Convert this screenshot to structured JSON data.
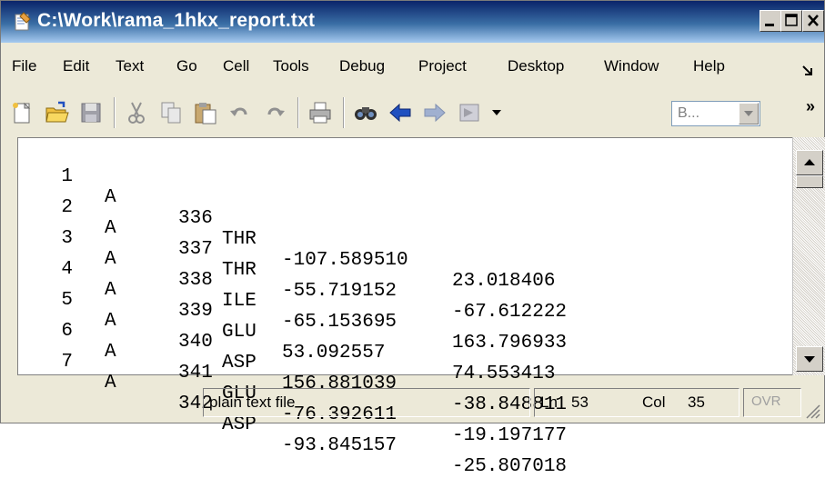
{
  "window": {
    "title": "C:\\Work\\rama_1hkx_report.txt",
    "minimize_label": "minimize",
    "maximize_label": "maximize",
    "close_label": "close"
  },
  "menu": [
    "File",
    "Edit",
    "Text",
    "Go",
    "Cell",
    "Tools",
    "Debug",
    "Project",
    "Desktop",
    "Window",
    "Help"
  ],
  "toolbar": {
    "icons": [
      "new-file-icon",
      "open-folder-icon",
      "save-icon",
      "cut-icon",
      "copy-icon",
      "paste-icon",
      "undo-icon",
      "redo-icon",
      "print-icon",
      "find-icon",
      "back-arrow-icon",
      "forward-arrow-icon",
      "goto-icon"
    ],
    "combo_value": "B...",
    "overflow": "»"
  },
  "editor": {
    "lines": [
      {
        "num": "1",
        "chain": "A",
        "res": "336",
        "name": "THR",
        "phi": "-107.589510",
        "psi": "23.018406"
      },
      {
        "num": "2",
        "chain": "A",
        "res": "337",
        "name": "THR",
        "phi": "-55.719152",
        "psi": "-67.612222"
      },
      {
        "num": "3",
        "chain": "A",
        "res": "338",
        "name": "ILE",
        "phi": "-65.153695",
        "psi": "163.796933"
      },
      {
        "num": "4",
        "chain": "A",
        "res": "339",
        "name": "GLU",
        "phi": "53.092557",
        "psi": "74.553413"
      },
      {
        "num": "5",
        "chain": "A",
        "res": "340",
        "name": "ASP",
        "phi": "156.881039",
        "psi": "-38.848811"
      },
      {
        "num": "6",
        "chain": "A",
        "res": "341",
        "name": "GLU",
        "phi": "-76.392611",
        "psi": "-19.197177"
      },
      {
        "num": "7",
        "chain": "A",
        "res": "342",
        "name": "ASP",
        "phi": "-93.845157",
        "psi": "-25.807018"
      }
    ]
  },
  "status": {
    "file_type": "plain text file",
    "ln_label": "Ln",
    "ln_value": "53",
    "col_label": "Col",
    "col_value": "35",
    "ovr": "OVR"
  }
}
